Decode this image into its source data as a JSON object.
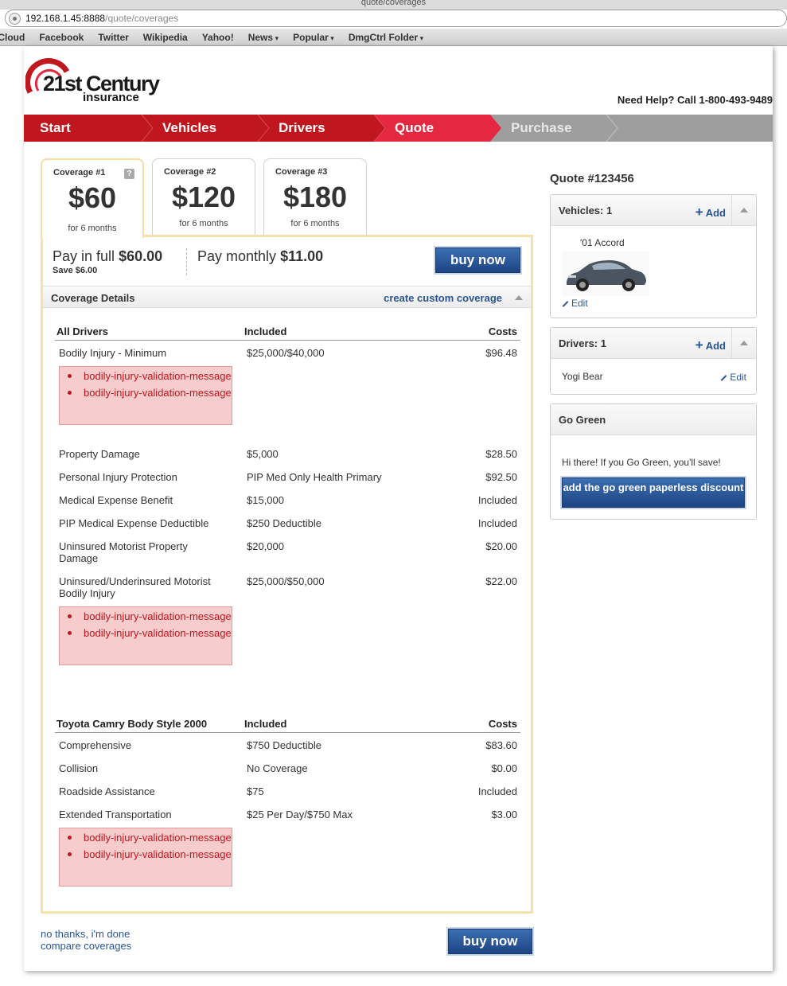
{
  "browser": {
    "window_title": "quote/coverages",
    "url_host": "192.168.1.45:8888",
    "url_path": "/quote/coverages",
    "bookmarks": [
      "iCloud",
      "Facebook",
      "Twitter",
      "Wikipedia",
      "Yahoo!",
      "News",
      "Popular",
      "DmgCtrl Folder"
    ]
  },
  "header": {
    "logo_main": "21st Century",
    "logo_sub": "insurance",
    "help": "Need Help? Call 1-800-493-9489"
  },
  "steps": [
    {
      "label": "Start",
      "state": "done"
    },
    {
      "label": "Vehicles",
      "state": "done"
    },
    {
      "label": "Drivers",
      "state": "done"
    },
    {
      "label": "Quote",
      "state": "current"
    },
    {
      "label": "Purchase",
      "state": "todo"
    }
  ],
  "colors": {
    "brand_red": "#c0161d",
    "current_red": "#e3283f",
    "link_blue": "#2a5592",
    "button_blue": "#1d4483"
  },
  "coverages": [
    {
      "label": "Coverage #1",
      "price": "$60",
      "period": "for 6 months",
      "help_icon": "?"
    },
    {
      "label": "Coverage #2",
      "price": "$120",
      "period": "for 6 months"
    },
    {
      "label": "Coverage #3",
      "price": "$180",
      "period": "for 6 months"
    }
  ],
  "payment": {
    "full_label": "Pay in full",
    "full_amount": "$60.00",
    "save": "Save $6.00",
    "monthly_label": "Pay monthly",
    "monthly_amount": "$11.00",
    "buy": "buy now"
  },
  "details": {
    "title": "Coverage Details",
    "custom_link": "create custom coverage",
    "drivers_table": {
      "headers": [
        "All Drivers",
        "Included",
        "Costs"
      ],
      "rows": [
        {
          "name": "Bodily Injury - Minimum",
          "included": "$25,000/$40,000",
          "cost": "$96.48"
        },
        {
          "name": "Property Damage",
          "included": "$5,000",
          "cost": "$28.50"
        },
        {
          "name": "Personal Injury Protection",
          "included": "PIP Med Only Health Primary",
          "cost": "$92.50"
        },
        {
          "name": "Medical Expense Benefit",
          "included": "$15,000",
          "cost": "Included"
        },
        {
          "name": "PIP Medical Expense Deductible",
          "included": "$250 Deductible",
          "cost": "Included"
        },
        {
          "name": "Uninsured Motorist Property Damage",
          "included": "$20,000",
          "cost": "$20.00"
        },
        {
          "name": "Uninsured/Underinsured Motorist Bodily Injury",
          "included": "$25,000/$50,000",
          "cost": "$22.00"
        }
      ]
    },
    "vehicle_table": {
      "headers": [
        "Toyota Camry Body Style 2000",
        "Included",
        "Costs"
      ],
      "rows": [
        {
          "name": "Comprehensive",
          "included": "$750 Deductible",
          "cost": "$83.60"
        },
        {
          "name": "Collision",
          "included": "No Coverage",
          "cost": "$0.00"
        },
        {
          "name": "Roadside Assistance",
          "included": "$75",
          "cost": "Included"
        },
        {
          "name": "Extended Transportation",
          "included": "$25 Per Day/$750 Max",
          "cost": "$3.00"
        }
      ]
    },
    "error_message": "bodily-injury-validation-message"
  },
  "footer": {
    "no_thanks": "no thanks, i'm done",
    "compare": "compare coverages",
    "buy": "buy now"
  },
  "sidebar": {
    "quote_no": "Quote #123456",
    "vehicles": {
      "title": "Vehicles: 1",
      "add": "Add",
      "item": "'01 Accord",
      "edit": "Edit"
    },
    "drivers": {
      "title": "Drivers: 1",
      "add": "Add",
      "item": "Yogi Bear",
      "edit": "Edit"
    },
    "green": {
      "title": "Go Green",
      "text": "Hi there! If you Go Green, you'll save!",
      "button": "add the go green paperless discount"
    }
  }
}
